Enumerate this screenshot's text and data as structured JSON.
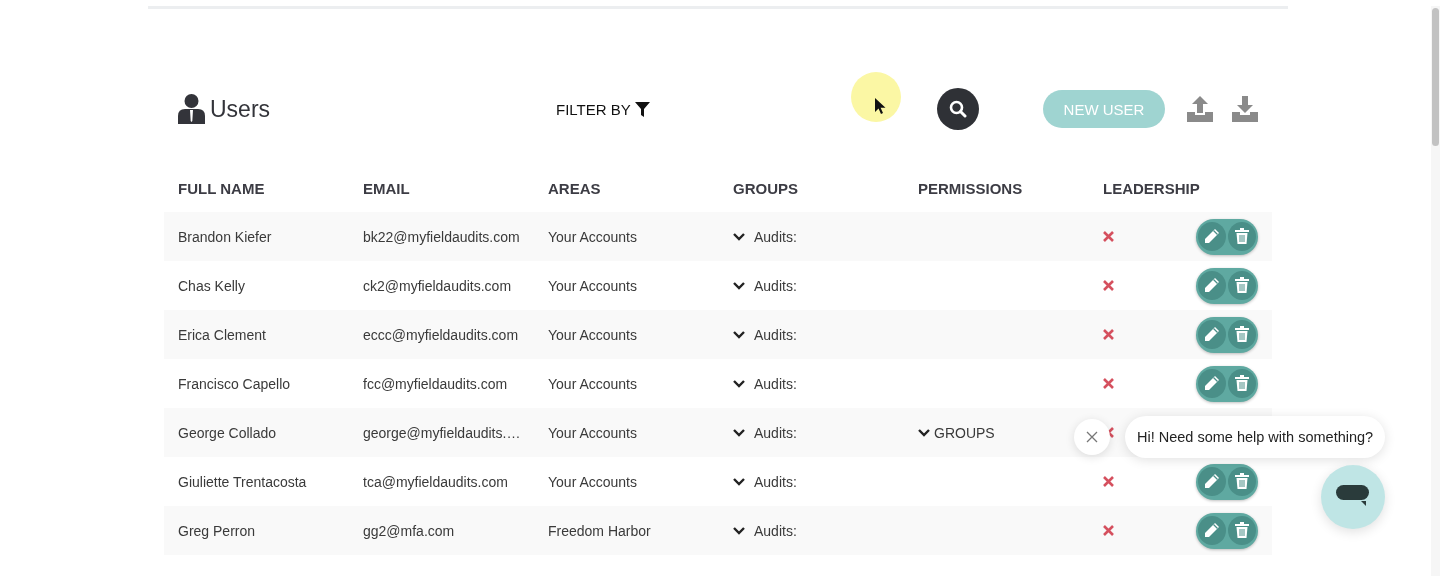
{
  "header": {
    "title": "Users",
    "filter_label": "FILTER BY",
    "new_user_button": "NEW USER"
  },
  "table": {
    "columns": [
      "FULL NAME",
      "EMAIL",
      "AREAS",
      "GROUPS",
      "PERMISSIONS",
      "LEADERSHIP"
    ],
    "rows": [
      {
        "full_name": "Brandon Kiefer",
        "email": "bk22@myfieldaudits.com",
        "area": "Your Accounts",
        "group": "Audits:",
        "leadership": false,
        "actions_visible": true
      },
      {
        "full_name": "Chas Kelly",
        "email": "ck2@myfieldaudits.com",
        "area": "Your Accounts",
        "group": "Audits:",
        "leadership": false,
        "actions_visible": true
      },
      {
        "full_name": "Erica Clement",
        "email": "eccc@myfieldaudits.com",
        "area": "Your Accounts",
        "group": "Audits:",
        "leadership": false,
        "actions_visible": true
      },
      {
        "full_name": "Francisco Capello",
        "email": "fcc@myfieldaudits.com",
        "area": "Your Accounts",
        "group": "Audits:",
        "leadership": false,
        "actions_visible": true
      },
      {
        "full_name": "George Collado",
        "email": "george@myfieldaudits.…",
        "area": "Your Accounts",
        "group": "Audits:",
        "permission": "GROUPS",
        "leadership": false,
        "actions_visible": false
      },
      {
        "full_name": "Giuliette Trentacosta",
        "email": "tca@myfieldaudits.com",
        "area": "Your Accounts",
        "group": "Audits:",
        "leadership": false,
        "actions_visible": true
      },
      {
        "full_name": "Greg Perron",
        "email": "gg2@mfa.com",
        "area": "Freedom Harbor",
        "group": "Audits:",
        "leadership": false,
        "actions_visible": true
      }
    ]
  },
  "chat": {
    "message": "Hi! Need some help with something?"
  }
}
